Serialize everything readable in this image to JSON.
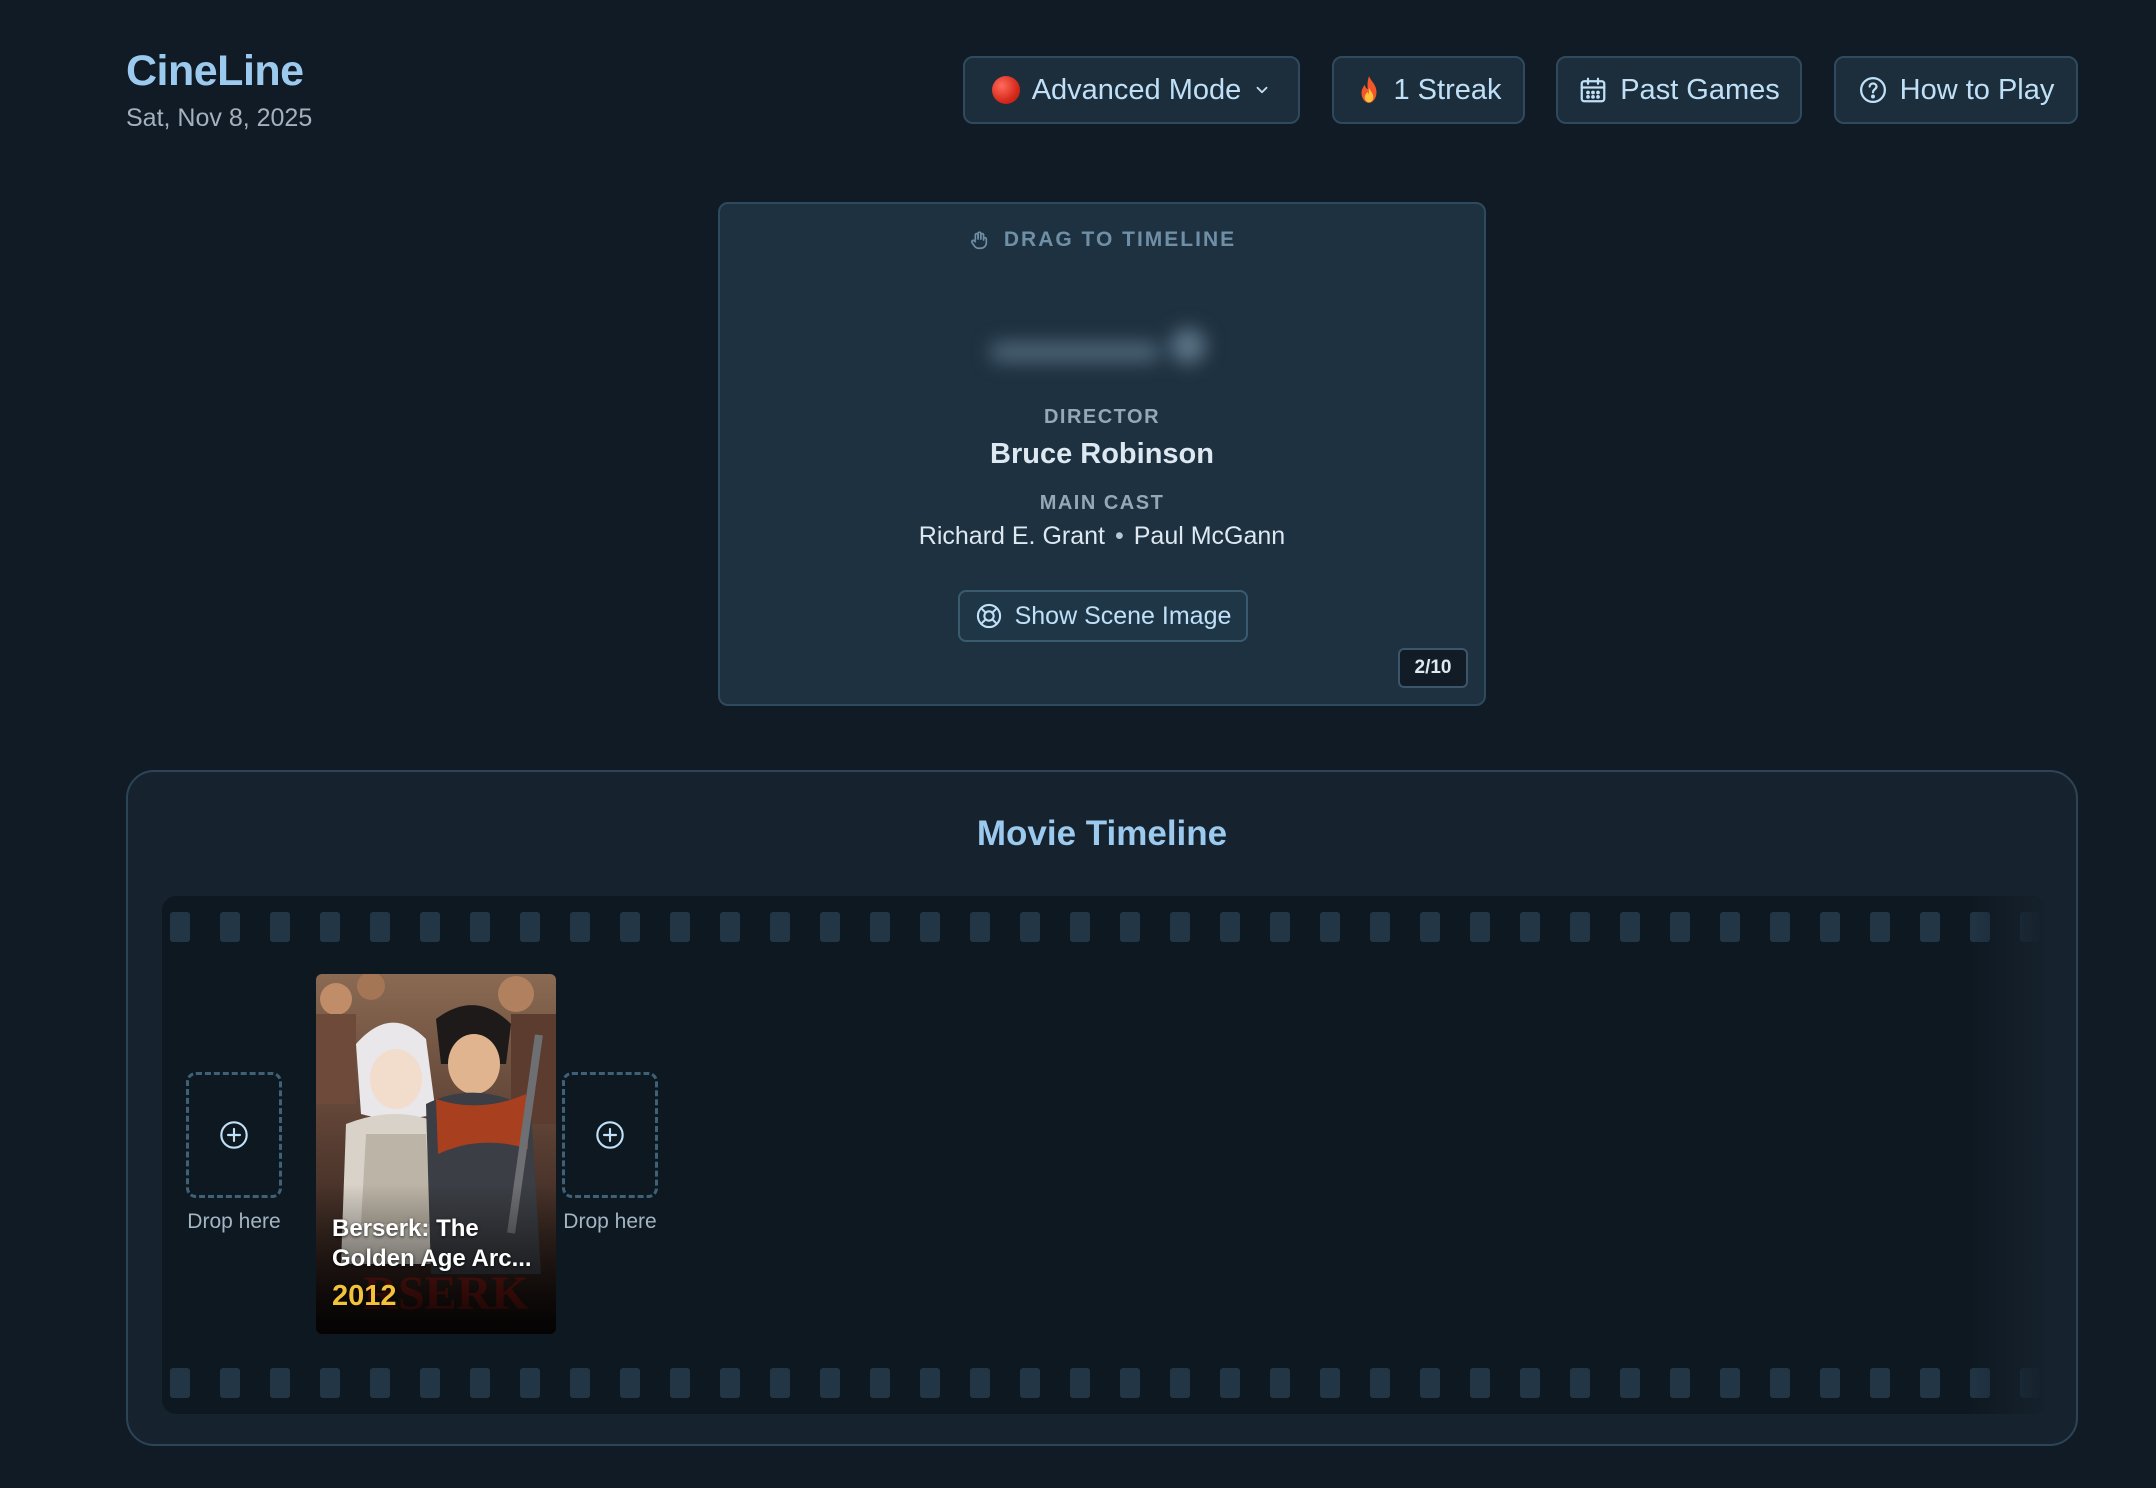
{
  "app": {
    "title": "CineLine",
    "date": "Sat, Nov 8, 2025"
  },
  "header": {
    "mode_label": "Advanced Mode",
    "streak_label": "1 Streak",
    "past_games_label": "Past Games",
    "how_to_play_label": "How to Play"
  },
  "clue": {
    "drag_hint": "DRAG TO TIMELINE",
    "director_label": "DIRECTOR",
    "director_name": "Bruce Robinson",
    "cast_label": "MAIN CAST",
    "cast": [
      "Richard E. Grant",
      "Paul McGann"
    ],
    "scene_button_label": "Show Scene Image",
    "counter": "2/10"
  },
  "timeline": {
    "title": "Movie Timeline",
    "drop_label": "Drop here",
    "cards": [
      {
        "title": "Berserk: The Golden Age Arc...",
        "year": "2012"
      }
    ]
  },
  "colors": {
    "background": "#111b25",
    "accent": "#9ccaef",
    "year": "#f2c338"
  }
}
